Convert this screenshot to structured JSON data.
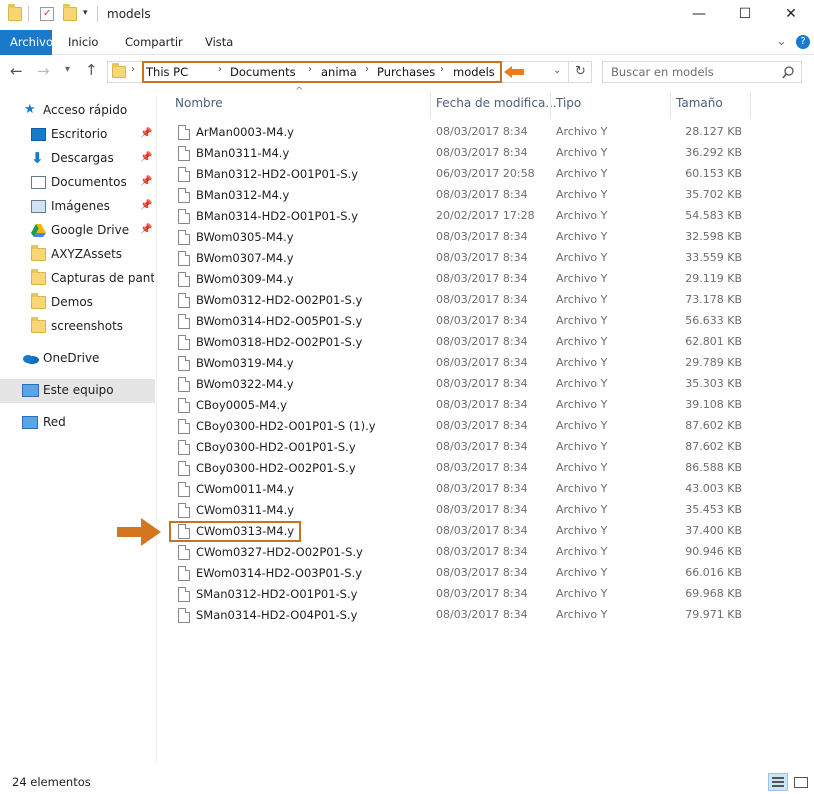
{
  "window": {
    "title": "models",
    "minimize_glyph": "—",
    "maximize_glyph": "☐",
    "close_glyph": "✕"
  },
  "ribbon": {
    "tabs": [
      "Archivo",
      "Inicio",
      "Compartir",
      "Vista"
    ],
    "expand_glyph": "⌄",
    "help_glyph": "?"
  },
  "address": {
    "crumbs": [
      "This PC",
      "Documents",
      "anima",
      "Purchases",
      "models"
    ],
    "search_placeholder": "Buscar en models"
  },
  "sidebar": {
    "quick_access": "Acceso rápido",
    "pinned": [
      {
        "label": "Escritorio",
        "icon": "desktop-icon"
      },
      {
        "label": "Descargas",
        "icon": "download-icon"
      },
      {
        "label": "Documentos",
        "icon": "documents-icon"
      },
      {
        "label": "Imágenes",
        "icon": "pictures-icon"
      },
      {
        "label": "Google Drive",
        "icon": "google-drive-icon"
      }
    ],
    "folders": [
      "AXYZAssets",
      "Capturas de pantalla",
      "Demos",
      "screenshots"
    ],
    "onedrive": "OneDrive",
    "this_pc": "Este equipo",
    "network": "Red"
  },
  "columns": {
    "name": "Nombre",
    "date": "Fecha de modifica...",
    "type": "Tipo",
    "size": "Tamaño"
  },
  "files": [
    {
      "name": "ArMan0003-M4.y",
      "date": "08/03/2017 8:34",
      "type": "Archivo Y",
      "size": "28.127 KB"
    },
    {
      "name": "BMan0311-M4.y",
      "date": "08/03/2017 8:34",
      "type": "Archivo Y",
      "size": "36.292 KB"
    },
    {
      "name": "BMan0312-HD2-O01P01-S.y",
      "date": "06/03/2017 20:58",
      "type": "Archivo Y",
      "size": "60.153 KB"
    },
    {
      "name": "BMan0312-M4.y",
      "date": "08/03/2017 8:34",
      "type": "Archivo Y",
      "size": "35.702 KB"
    },
    {
      "name": "BMan0314-HD2-O01P01-S.y",
      "date": "20/02/2017 17:28",
      "type": "Archivo Y",
      "size": "54.583 KB"
    },
    {
      "name": "BWom0305-M4.y",
      "date": "08/03/2017 8:34",
      "type": "Archivo Y",
      "size": "32.598 KB"
    },
    {
      "name": "BWom0307-M4.y",
      "date": "08/03/2017 8:34",
      "type": "Archivo Y",
      "size": "33.559 KB"
    },
    {
      "name": "BWom0309-M4.y",
      "date": "08/03/2017 8:34",
      "type": "Archivo Y",
      "size": "29.119 KB"
    },
    {
      "name": "BWom0312-HD2-O02P01-S.y",
      "date": "08/03/2017 8:34",
      "type": "Archivo Y",
      "size": "73.178 KB"
    },
    {
      "name": "BWom0314-HD2-O05P01-S.y",
      "date": "08/03/2017 8:34",
      "type": "Archivo Y",
      "size": "56.633 KB"
    },
    {
      "name": "BWom0318-HD2-O02P01-S.y",
      "date": "08/03/2017 8:34",
      "type": "Archivo Y",
      "size": "62.801 KB"
    },
    {
      "name": "BWom0319-M4.y",
      "date": "08/03/2017 8:34",
      "type": "Archivo Y",
      "size": "29.789 KB"
    },
    {
      "name": "BWom0322-M4.y",
      "date": "08/03/2017 8:34",
      "type": "Archivo Y",
      "size": "35.303 KB"
    },
    {
      "name": "CBoy0005-M4.y",
      "date": "08/03/2017 8:34",
      "type": "Archivo Y",
      "size": "39.108 KB"
    },
    {
      "name": "CBoy0300-HD2-O01P01-S (1).y",
      "date": "08/03/2017 8:34",
      "type": "Archivo Y",
      "size": "87.602 KB"
    },
    {
      "name": "CBoy0300-HD2-O01P01-S.y",
      "date": "08/03/2017 8:34",
      "type": "Archivo Y",
      "size": "87.602 KB"
    },
    {
      "name": "CBoy0300-HD2-O02P01-S.y",
      "date": "08/03/2017 8:34",
      "type": "Archivo Y",
      "size": "86.588 KB"
    },
    {
      "name": "CWom0011-M4.y",
      "date": "08/03/2017 8:34",
      "type": "Archivo Y",
      "size": "43.003 KB"
    },
    {
      "name": "CWom0311-M4.y",
      "date": "08/03/2017 8:34",
      "type": "Archivo Y",
      "size": "35.453 KB"
    },
    {
      "name": "CWom0313-M4.y",
      "date": "08/03/2017 8:34",
      "type": "Archivo Y",
      "size": "37.400 KB"
    },
    {
      "name": "CWom0327-HD2-O02P01-S.y",
      "date": "08/03/2017 8:34",
      "type": "Archivo Y",
      "size": "90.946 KB"
    },
    {
      "name": "EWom0314-HD2-O03P01-S.y",
      "date": "08/03/2017 8:34",
      "type": "Archivo Y",
      "size": "66.016 KB"
    },
    {
      "name": "SMan0312-HD2-O01P01-S.y",
      "date": "08/03/2017 8:34",
      "type": "Archivo Y",
      "size": "69.968 KB"
    },
    {
      "name": "SMan0314-HD2-O04P01-S.y",
      "date": "08/03/2017 8:34",
      "type": "Archivo Y",
      "size": "79.971 KB"
    }
  ],
  "highlighted_file_index": 19,
  "status": {
    "count": "24 elementos"
  },
  "colors": {
    "accent": "#1979ca",
    "annotation": "#c8731f"
  }
}
